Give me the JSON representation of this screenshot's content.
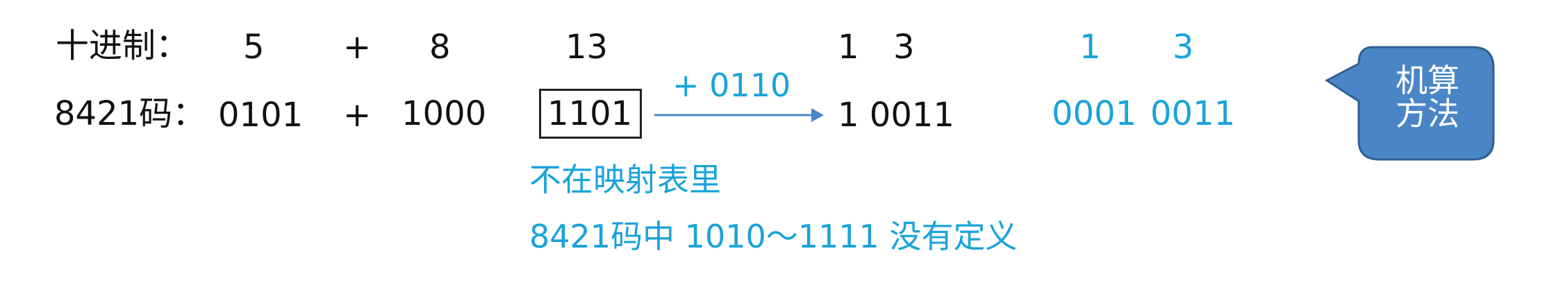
{
  "rows": {
    "decimal": {
      "label": "十进制：",
      "a": "5",
      "op": "+",
      "b": "8",
      "sum": "13",
      "split_tens": "1",
      "split_ones": "3",
      "result_tens": "1",
      "result_ones": "3"
    },
    "bcd": {
      "label": "8421码：",
      "a": "0101",
      "op": "+",
      "b": "1000",
      "sum": "1101",
      "correction": "+ 0110",
      "corrected": "1 0011",
      "result_tens": "0001",
      "result_ones": "0011"
    }
  },
  "notes": {
    "line1": "不在映射表里",
    "line2": "8421码中 1010～1111 没有定义"
  },
  "callout": {
    "line1": "机算",
    "line2": "方法"
  },
  "colors": {
    "text": "#111111",
    "accent": "#1aa3d9",
    "callout_fill": "#4a86c6",
    "callout_border": "#2f5f94",
    "arrow": "#4a86c6"
  }
}
